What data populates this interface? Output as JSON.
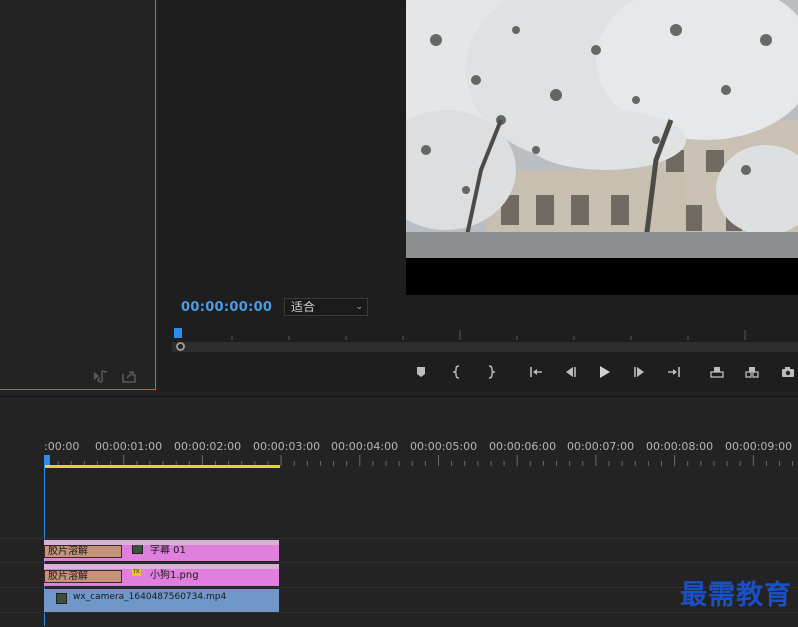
{
  "monitor": {
    "timecode": "00:00:00:00",
    "fit_select": "适合"
  },
  "timeline": {
    "ruler_labels": [
      ":00:00",
      "00:00:01:00",
      "00:00:02:00",
      "00:00:03:00",
      "00:00:04:00",
      "00:00:05:00",
      "00:00:06:00",
      "00:00:07:00",
      "00:00:08:00",
      "00:00:09:00"
    ],
    "tracks": {
      "v3": {
        "transition": "胶片溶解",
        "clip": "字幕 01",
        "icon": "title-icon"
      },
      "v2": {
        "transition": "胶片溶解",
        "clip": "小狗1.png",
        "icon": "fx-icon",
        "fx": "fx"
      },
      "v1": {
        "clip": "wx_camera_1640487560734.mp4",
        "icon": "video-icon"
      }
    }
  },
  "watermark": "最需教育",
  "colors": {
    "accent": "#2d8ceb",
    "work_area": "#e5d13a",
    "pink_clip": "#e07fdd",
    "blue_clip": "#6f97c7",
    "transition": "#c4937a"
  }
}
